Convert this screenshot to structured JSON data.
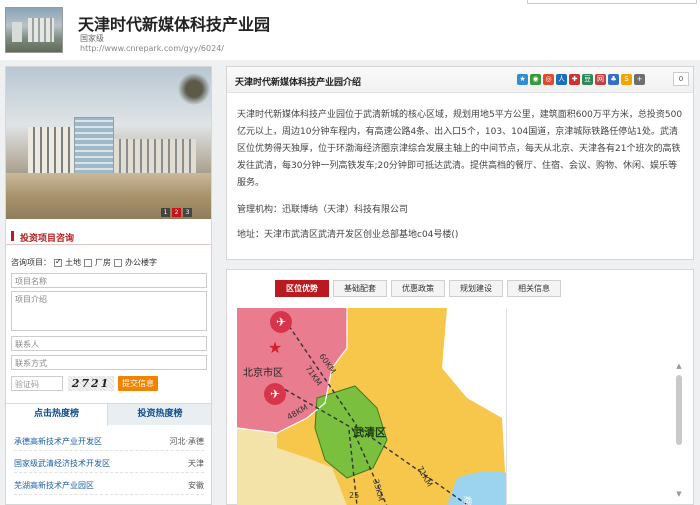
{
  "header": {
    "title": "天津时代新媒体科技产业园",
    "level": "国家级",
    "url": "http://www.cnrepark.com/gyy/6024/"
  },
  "photo": {
    "pages": [
      "1",
      "2",
      "3"
    ],
    "active_page": "2"
  },
  "inquiry": {
    "title": "投资项目咨询",
    "type_label": "咨询项目：",
    "options": [
      {
        "label": "土地",
        "checked": true
      },
      {
        "label": "厂房",
        "checked": false
      },
      {
        "label": "办公楼字",
        "checked": false
      }
    ],
    "project_name_placeholder": "项目名称",
    "project_intro_placeholder": "项目介绍",
    "contact_placeholder": "联系人",
    "phone_placeholder": "联系方式",
    "captcha_placeholder": "验证码",
    "captcha_text": "2721",
    "submit_label": "提交信息"
  },
  "ranking": {
    "tabs": [
      "点击热度榜",
      "投资热度榜"
    ],
    "active_tab": "点击热度榜",
    "rows": [
      {
        "name": "承德高新技术产业开发区",
        "region": "河北·承德"
      },
      {
        "name": "国家级武清经济技术开发区",
        "region": "天津"
      },
      {
        "name": "芜湖高新技术产业园区",
        "region": "安徽"
      }
    ]
  },
  "intro": {
    "title": "天津时代新媒体科技产业园介绍",
    "share_count": "0",
    "body": "天津时代新媒体科技产业园位于武清新城的核心区域，规划用地5平方公里，建筑面积600万平方米，总投资500亿元以上，周边10分钟车程内，有高速公路4条、出入口5个，103、104国道，京津城际铁路任停站1处。武清区位优势得天独厚，位于环渤海经济圈京津综合发展主轴上的中间节点，每天从北京、天津各有21个班次的高铁发往武清，每30分钟一列高铁发车;20分钟即可抵达武清。提供高档的餐厅、住宿、会议、购物、休闲、娱乐等服务。",
    "management": "管理机构：迅联博纳（天津）科技有限公司",
    "address": "地址：天津市武清区武清开发区创业总部基地c04号楼()",
    "share_icons": [
      {
        "name": "qzone-icon",
        "color": "#2e8fd4"
      },
      {
        "name": "weibo-icon",
        "color": "#3a9a3a"
      },
      {
        "name": "tqq-icon",
        "color": "#e04a2e"
      },
      {
        "name": "renren-icon",
        "color": "#1b6fb7"
      },
      {
        "name": "kaixin-icon",
        "color": "#d2322d"
      },
      {
        "name": "douban-icon",
        "color": "#2e8b57"
      },
      {
        "name": "netease-icon",
        "color": "#c43f3f"
      },
      {
        "name": "baidu-icon",
        "color": "#3270c8"
      },
      {
        "name": "sohu-icon",
        "color": "#f2a400"
      },
      {
        "name": "more-icon",
        "color": "#6e6e6e"
      }
    ]
  },
  "detail": {
    "tabs": [
      "区位优势",
      "基础配套",
      "优惠政策",
      "规划建设",
      "相关信息"
    ],
    "active_tab": "区位优势"
  },
  "map": {
    "beijing_label": "北京市区",
    "wuqing_label": "武清区",
    "distances": [
      "60KM",
      "71KM",
      "48KM",
      "71KM",
      "35KM"
    ],
    "partial_labels": [
      "渤",
      "25"
    ]
  }
}
